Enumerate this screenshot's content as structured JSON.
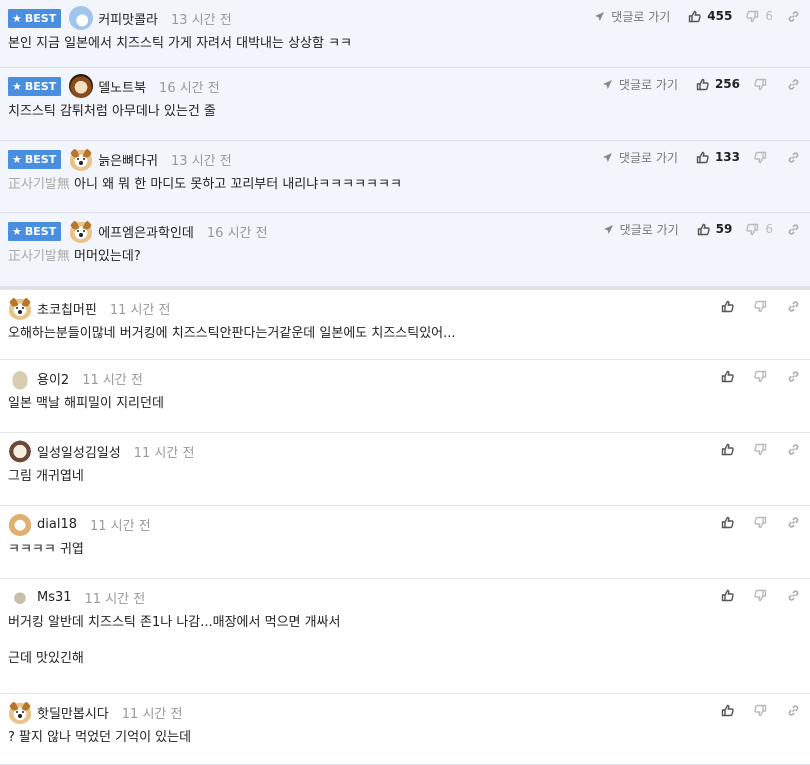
{
  "labels": {
    "best": "BEST",
    "reply_link": "댓글로 가기"
  },
  "comments": [
    {
      "best": true,
      "avatar": "blue",
      "nick": "커피맛콜라",
      "time": "13 시간 전",
      "prefix": "",
      "text": "본인 지금 일본에서 치즈스틱 가게 자려서 대박내는 상상함 ㅋㅋ",
      "up": "455",
      "down": "6"
    },
    {
      "best": true,
      "avatar": "dark",
      "nick": "델노트북",
      "time": "16 시간 전",
      "prefix": "",
      "text": "치즈스틱 감튀처럼 아무데나 있는건 줄",
      "up": "256",
      "down": ""
    },
    {
      "best": true,
      "avatar": "dog",
      "nick": "늙은뼈다귀",
      "time": "13 시간 전",
      "prefix": "正사기발無",
      "text": "아니 왜 뭐 한 마디도 못하고 꼬리부터 내리냐ㅋㅋㅋㅋㅋㅋㅋ",
      "up": "133",
      "down": ""
    },
    {
      "best": true,
      "avatar": "dog",
      "nick": "에프엠은과학인데",
      "time": "16 시간 전",
      "prefix": "正사기발無",
      "text": "머머있는데?",
      "up": "59",
      "down": "6"
    },
    {
      "best": false,
      "avatar": "dog",
      "nick": "초코칩머핀",
      "time": "11 시간 전",
      "prefix": "",
      "text": "오해하는분들이많네 버거킹에 치즈스틱안판다는거같운데 일본에도 치즈스틱있어...",
      "up": "",
      "down": ""
    },
    {
      "best": false,
      "avatar": "stone",
      "nick": "용이2",
      "time": "11 시간 전",
      "prefix": "",
      "text": "일본 맥날 해피밀이 지리던데",
      "up": "",
      "down": ""
    },
    {
      "best": false,
      "avatar": "puppy",
      "nick": "일성일성김일성",
      "time": "11 시간 전",
      "prefix": "",
      "text": "그림 개귀엽네",
      "up": "",
      "down": ""
    },
    {
      "best": false,
      "avatar": "shib",
      "nick": "dial18",
      "time": "11 시간 전",
      "prefix": "",
      "text": "ㅋㅋㅋㅋ 귀엽",
      "up": "",
      "down": ""
    },
    {
      "best": false,
      "avatar": "dot",
      "nick": "Ms31",
      "time": "11 시간 전",
      "prefix": "",
      "text": "버거킹 알반데 치즈스틱 존1나 나감...매장에서 먹으면 개싸서\n\n근데 맛있긴해",
      "up": "",
      "down": ""
    },
    {
      "best": false,
      "avatar": "dog",
      "nick": "핫딜만봅시다",
      "time": "11 시간 전",
      "prefix": "",
      "text": "? 팔지 않나 먹었던 기억이 있는데",
      "up": "",
      "down": ""
    }
  ]
}
